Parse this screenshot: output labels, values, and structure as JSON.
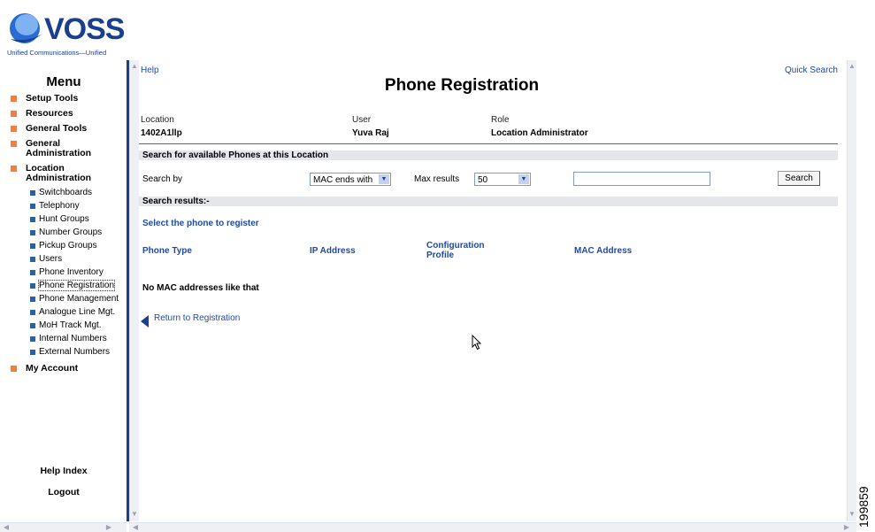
{
  "logo": {
    "name": "VOSS",
    "tagline": "Unified Communications—Unified"
  },
  "menu": {
    "title": "Menu",
    "items": [
      {
        "label": "Setup Tools"
      },
      {
        "label": "Resources"
      },
      {
        "label": "General Tools"
      },
      {
        "label": "General Administration"
      },
      {
        "label": "Location Administration"
      }
    ],
    "location_subitems": [
      {
        "label": "Switchboards"
      },
      {
        "label": "Telephony"
      },
      {
        "label": "Hunt Groups"
      },
      {
        "label": "Number Groups"
      },
      {
        "label": "Pickup Groups"
      },
      {
        "label": "Users"
      },
      {
        "label": "Phone Inventory"
      },
      {
        "label": "Phone Registration"
      },
      {
        "label": "Phone Management"
      },
      {
        "label": "Analogue Line Mgt."
      },
      {
        "label": "MoH Track Mgt."
      },
      {
        "label": "Internal Numbers"
      },
      {
        "label": "External Numbers"
      }
    ],
    "account": {
      "label": "My Account"
    },
    "help_index": "Help Index",
    "logout": "Logout",
    "selected": "Phone Registration"
  },
  "header": {
    "help": "Help",
    "quick_search": "Quick Search",
    "title": "Phone Registration"
  },
  "info": {
    "location_label": "Location",
    "location_value": "1402A1llp",
    "user_label": "User",
    "user_value": "Yuva Raj",
    "role_label": "Role",
    "role_value": "Location Administrator"
  },
  "search": {
    "section_title": "Search for available Phones at this Location",
    "search_by_label": "Search by",
    "search_by_value": "MAC ends with",
    "max_results_label": "Max results",
    "max_results_value": "50",
    "query_value": "",
    "button": "Search"
  },
  "results": {
    "section_title": "Search results:-",
    "prompt": "Select the phone to register",
    "columns": [
      "Phone Type",
      "IP Address",
      "Configuration Profile",
      "MAC Address"
    ],
    "message": "No MAC addresses like that",
    "return_link": "Return to Registration"
  },
  "figure_id": "199859",
  "colors": {
    "brand": "#1b3f8f",
    "link": "#1f4aa8",
    "bullet": "#e8824a",
    "section_bar": "#e4e6ea"
  }
}
